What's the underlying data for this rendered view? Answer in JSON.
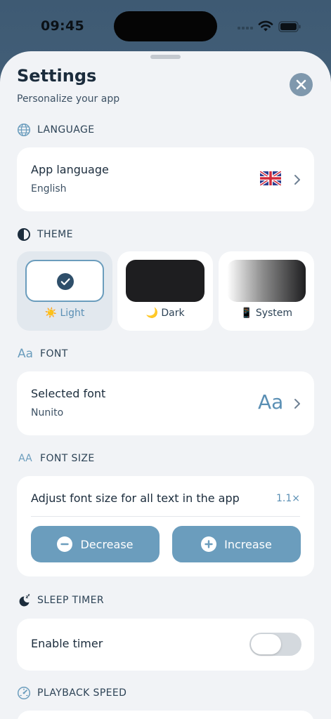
{
  "status_bar": {
    "time": "09:45"
  },
  "sheet": {
    "title": "Settings",
    "subtitle": "Personalize your app"
  },
  "sections": {
    "language": {
      "header": "LANGUAGE",
      "row_title": "App language",
      "row_value": "English",
      "flag_icon": "uk-flag-icon"
    },
    "theme": {
      "header": "THEME",
      "options": [
        {
          "emoji": "☀️",
          "label": "Light",
          "selected": true
        },
        {
          "emoji": "🌙",
          "label": "Dark",
          "selected": false
        },
        {
          "emoji": "📱",
          "label": "System",
          "selected": false
        }
      ]
    },
    "font": {
      "header": "FONT",
      "header_icon_text": "Aa",
      "row_title": "Selected font",
      "row_value": "Nunito",
      "preview": "Aa"
    },
    "font_size": {
      "header": "FONT SIZE",
      "header_icon_text": "AA",
      "description": "Adjust font size for all text in the app",
      "value": "1.1×",
      "decrease_label": "Decrease",
      "increase_label": "Increase"
    },
    "sleep_timer": {
      "header": "SLEEP TIMER",
      "row_title": "Enable timer",
      "enabled": false
    },
    "playback_speed": {
      "header": "PLAYBACK SPEED"
    }
  },
  "colors": {
    "accent": "#6b9dbd",
    "sheet_background": "#f1f3f6",
    "text_primary": "#1b2c3c",
    "check_badge": "#2f4f6a"
  }
}
